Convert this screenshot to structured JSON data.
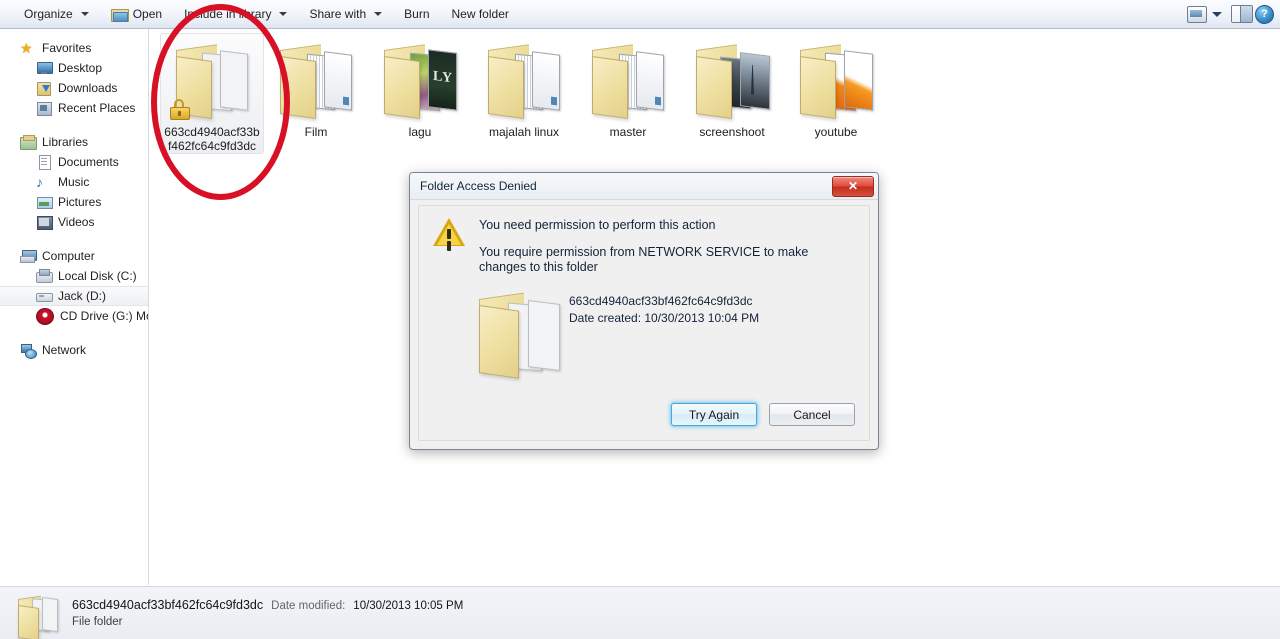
{
  "toolbar": {
    "items": [
      {
        "label": "Organize",
        "icon": null,
        "caret": true
      },
      {
        "label": "Open",
        "icon": "open-folder-icon",
        "caret": false
      },
      {
        "label": "Include in library",
        "icon": null,
        "caret": true
      },
      {
        "label": "Share with",
        "icon": null,
        "caret": true
      },
      {
        "label": "Burn",
        "icon": null,
        "caret": false
      },
      {
        "label": "New folder",
        "icon": null,
        "caret": false
      }
    ],
    "right": {
      "view_mode_icon": "view-mode-icon",
      "view_mode_caret": "chevron-down-icon",
      "preview_pane_icon": "preview-pane-icon",
      "help_icon": "help-icon",
      "help_glyph": "?"
    }
  },
  "sidebar": {
    "groups": [
      {
        "header": {
          "label": "Favorites",
          "icon": "star-icon"
        },
        "items": [
          {
            "label": "Desktop",
            "icon": "desktop-icon"
          },
          {
            "label": "Downloads",
            "icon": "downloads-icon"
          },
          {
            "label": "Recent Places",
            "icon": "recent-places-icon"
          }
        ]
      },
      {
        "header": {
          "label": "Libraries",
          "icon": "libraries-icon"
        },
        "items": [
          {
            "label": "Documents",
            "icon": "documents-icon"
          },
          {
            "label": "Music",
            "icon": "music-icon"
          },
          {
            "label": "Pictures",
            "icon": "pictures-icon"
          },
          {
            "label": "Videos",
            "icon": "videos-icon"
          }
        ]
      },
      {
        "header": {
          "label": "Computer",
          "icon": "computer-icon"
        },
        "items": [
          {
            "label": "Local Disk (C:)",
            "icon": "local-disk-icon",
            "selected": false
          },
          {
            "label": "Jack (D:)",
            "icon": "drive-icon",
            "selected": true
          },
          {
            "label": "CD Drive (G:) Moder",
            "icon": "cd-drive-icon",
            "selected": false
          }
        ]
      },
      {
        "header": {
          "label": "Network",
          "icon": "network-icon"
        },
        "items": []
      }
    ]
  },
  "content": {
    "folders": [
      {
        "name": "663cd4940acf33bf462fc64c9fd3dc",
        "variant": "plain",
        "locked": true,
        "selected": true
      },
      {
        "name": "Film",
        "variant": "magazine",
        "locked": false,
        "selected": false
      },
      {
        "name": "lagu",
        "variant": "lagu",
        "locked": false,
        "selected": false
      },
      {
        "name": "majalah linux",
        "variant": "magazine",
        "locked": false,
        "selected": false
      },
      {
        "name": "master",
        "variant": "magazine",
        "locked": false,
        "selected": false
      },
      {
        "name": "screenshoot",
        "variant": "screenshot",
        "locked": false,
        "selected": false
      },
      {
        "name": "youtube",
        "variant": "youtube",
        "locked": false,
        "selected": false
      }
    ],
    "annotation": {
      "shape": "red-ellipse",
      "color": "#d81026"
    }
  },
  "dialog": {
    "title": "Folder Access Denied",
    "close_glyph": "✕",
    "warning_icon": "warning-triangle-icon",
    "message_primary": "You need permission to perform this action",
    "message_secondary": "You require permission from NETWORK SERVICE to make changes to this folder",
    "folder_icon": "folder-icon",
    "folder_name": "663cd4940acf33bf462fc64c9fd3dc",
    "folder_date_created": "Date created: 10/30/2013 10:04 PM",
    "buttons": {
      "primary": "Try Again",
      "secondary": "Cancel"
    }
  },
  "statusbar": {
    "icon": "folder-icon",
    "name": "663cd4940acf33bf462fc64c9fd3dc",
    "date_modified_label": "Date modified:",
    "date_modified_value": "10/30/2013 10:05 PM",
    "type": "File folder"
  }
}
